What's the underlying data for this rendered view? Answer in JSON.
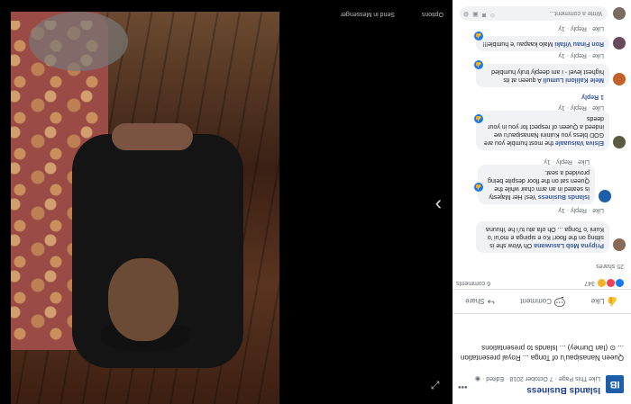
{
  "page": {
    "name": "Islands Business",
    "logo_text": "IB",
    "meta": "Like This Page · 7 October 2018 · Edited · ◉",
    "caption": "Queen Nanasipau'u of Tonga ... Royal presentation ... ⊙ (Ian Durney) ... Islands to presentations"
  },
  "actions": {
    "like": "Like",
    "comment": "Comment",
    "share": "Share"
  },
  "reactions": {
    "count": "347",
    "comments": "6 comments",
    "shares": "25 shares"
  },
  "comments": [
    {
      "author": "Pripyna Mob Lasuwana",
      "text": "Oh Wow she is sitting on the floor! Ko e sipinga e mo'ui 'o Kuini 'o Tonga ... Oh ofa atu tuʻi he 'ihuuna",
      "like": "Like",
      "reply": "Reply",
      "time": "1y"
    },
    {
      "author": "Islands Business",
      "text": "Yes! Her Majesty is seated in an arm chair while the Queen sat on the floor despite being provided a seat.",
      "like": "Like",
      "reply": "Reply",
      "time": "1y"
    },
    {
      "author": "Elsiva Vaisuaale",
      "text": "the most humble you are GOD bless you Kuinini Nanasipau'u we indeed a Queen of respect for you in your deeds",
      "like": "Like",
      "reply": "Reply",
      "time": "1y",
      "reply_label": "1 Reply"
    },
    {
      "author": "Mele Kaliloni Lumuli",
      "text": "A queen at its highest level - i am deeply truly humbled",
      "like": "Like",
      "reply": "Reply",
      "time": "1y"
    },
    {
      "author": "Ron Finau Vifaki",
      "text": "Malo kaapau 'e humble!!!",
      "like": "Like",
      "reply": "Reply",
      "time": "1y"
    }
  ],
  "comment_input": {
    "placeholder": "Write a comment..."
  },
  "viewer": {
    "link_1": "Options",
    "link_2": "Send in Messenger",
    "next": "›",
    "expand": "⤢"
  },
  "colors": {
    "brand": "#1c5fa8",
    "link": "#385898",
    "like": "#1877f2"
  }
}
